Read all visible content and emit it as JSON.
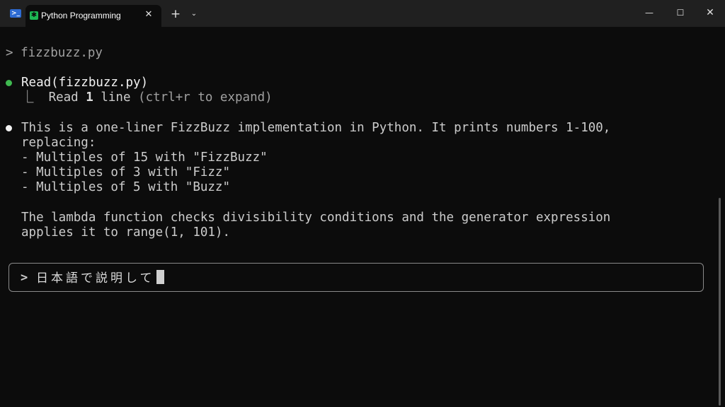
{
  "window": {
    "tab_title": "Python Programming",
    "icons": {
      "app": "powershell-icon",
      "tab": "claude-asterisk-icon",
      "close_tab": "close-icon",
      "new_tab": "plus-icon",
      "dropdown": "chevron-down-icon",
      "minimize": "minimize-icon",
      "maximize": "maximize-icon",
      "close_window": "close-icon"
    },
    "glyphs": {
      "app": ">_",
      "tab": "✱",
      "close_tab": "✕",
      "new_tab": "+",
      "dropdown": "⌄",
      "minimize": "—",
      "maximize": "☐",
      "close_window": "✕"
    }
  },
  "terminal": {
    "prompt_command": "> fizzbuzz.py",
    "tool_call": {
      "status_color": "#3fb950",
      "name": "Read(fizzbuzz.py)",
      "result_prefix": "⎿  Read ",
      "result_count": "1",
      "result_suffix": " line",
      "result_hint": " (ctrl+r to expand)"
    },
    "response": {
      "lines": [
        "This is a one-liner FizzBuzz implementation in Python. It prints numbers 1-100,",
        "replacing:",
        "- Multiples of 15 with \"FizzBuzz\"",
        "- Multiples of 3 with \"Fizz\"",
        "- Multiples of 5 with \"Buzz\"",
        "",
        "The lambda function checks divisibility conditions and the generator expression",
        "applies it to range(1, 101)."
      ]
    },
    "input": {
      "prompt": ">",
      "value": "日本語で説明して"
    }
  }
}
